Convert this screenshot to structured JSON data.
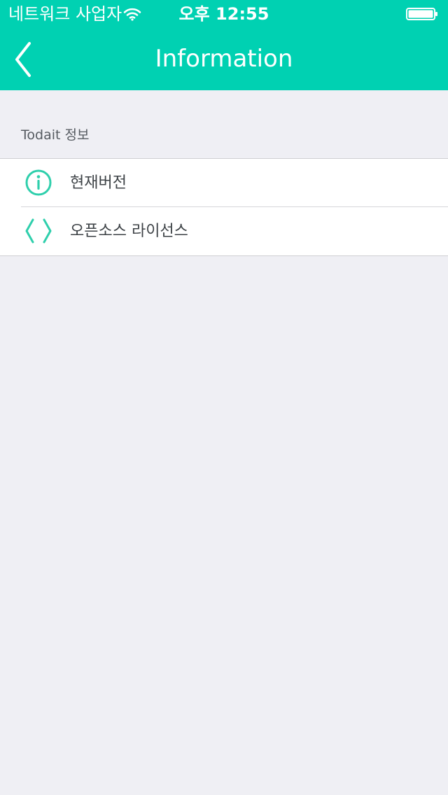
{
  "status_bar": {
    "carrier": "네트워크 사업자",
    "time": "오후 12:55",
    "wifi_icon": "wifi-icon",
    "battery_icon": "battery-icon"
  },
  "nav": {
    "title": "Information",
    "back_icon": "chevron-left-icon"
  },
  "section": {
    "label": "Todait 정보"
  },
  "items": [
    {
      "label": "현재버전",
      "icon": "info-icon"
    },
    {
      "label": "오픈소스 라이선스",
      "icon": "code-brackets-icon"
    }
  ],
  "colors": {
    "accent": "#00d1b2",
    "icon_accent": "#2fcfac",
    "background": "#efeff4"
  }
}
